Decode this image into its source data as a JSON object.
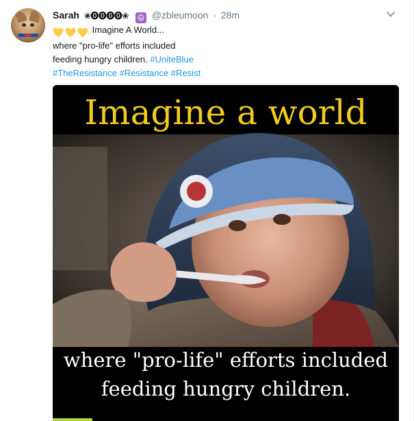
{
  "tweet": {
    "author": {
      "name": "Sarah",
      "name_icons": "❀⓿⓿⓿⓿❀",
      "handle": "@zbleumoon",
      "time": "28m"
    },
    "text": {
      "line1": "Imagine A World...",
      "line2": "where \"pro-life\" efforts included",
      "line3_plain": "feeding hungry children. ",
      "hashtags": [
        "#UniteBlue",
        "#TheResistance",
        "#Resistance",
        "#Resist"
      ]
    },
    "media": {
      "caption_top": "Imagine a world",
      "caption_bottom_1": "where \"pro-life\" efforts included",
      "caption_bottom_2": "feeding hungry children."
    }
  },
  "colors": {
    "link": "#1b95e0",
    "muted": "#657786",
    "heart": "#ffcc4d",
    "caption_yellow": "#f2cc1c"
  },
  "icons": [
    "avatar",
    "peace-symbol-icon",
    "chevron-down-icon",
    "yellow-heart-icon"
  ]
}
